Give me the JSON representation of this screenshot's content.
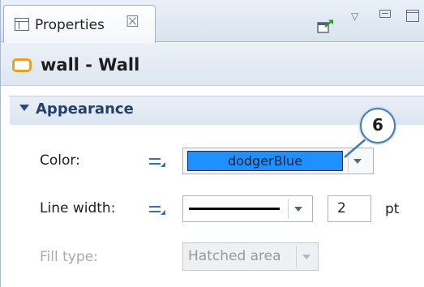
{
  "tab": {
    "label": "Properties",
    "close_glyph": "☒"
  },
  "toolbar": {
    "icons": [
      "pin-icon",
      "view-menu-icon",
      "minimize-icon",
      "maximize-icon"
    ]
  },
  "object": {
    "title": "wall - Wall",
    "icon": "wall-icon",
    "icon_color": "#e8a125"
  },
  "section": {
    "title": "Appearance",
    "expanded": true
  },
  "properties": {
    "color": {
      "label": "Color:",
      "value": "dodgerBlue",
      "swatch": "#1e90ff"
    },
    "line_width": {
      "label": "Line width:",
      "value": "2",
      "unit": "pt"
    },
    "fill_type": {
      "label": "Fill type:",
      "value": "Hatched area",
      "enabled": false
    }
  },
  "callout": {
    "number": "6",
    "color": "#4679b7"
  }
}
